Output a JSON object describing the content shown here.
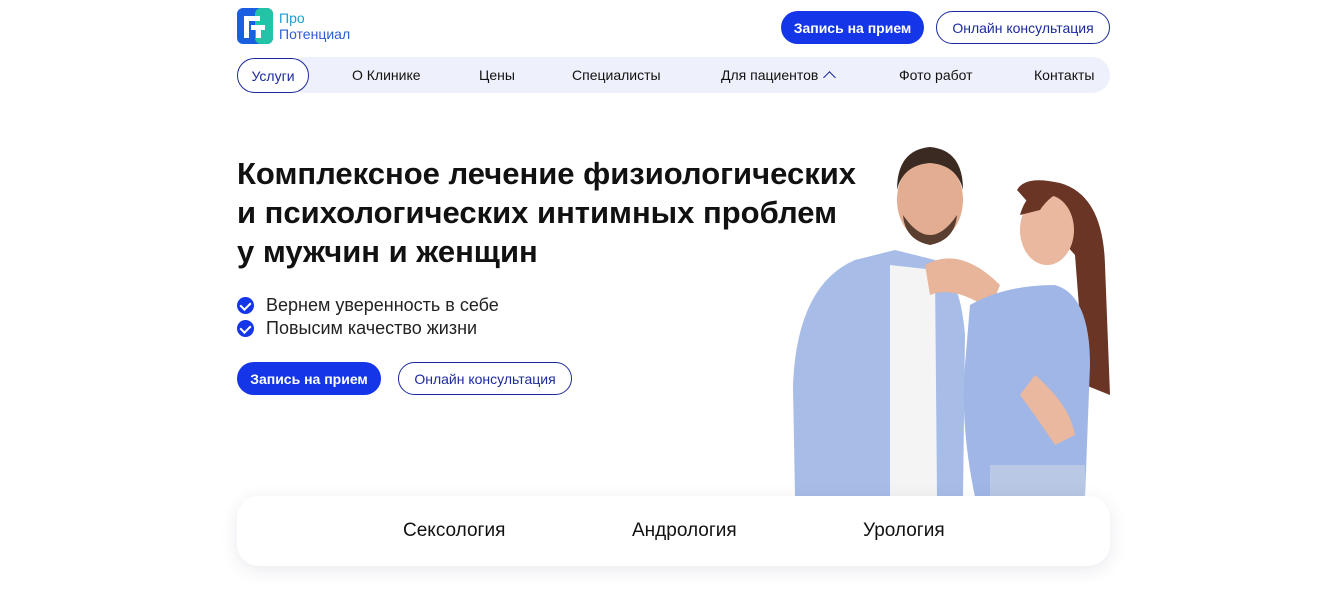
{
  "logo": {
    "line1": "Про",
    "line2": "Потенциал"
  },
  "header": {
    "appointment_label": "Запись на прием",
    "online_label": "Онлайн консультация"
  },
  "nav": {
    "services": "Услуги",
    "items": [
      "О Клинике",
      "Цены",
      "Специалисты",
      "Для пациентов",
      "Фото работ",
      "Контакты"
    ]
  },
  "hero": {
    "title": "Комплексное лечение физиологических и психологических интимных проблем у мужчин и женщин",
    "bullets": [
      "Вернем уверенность в себе",
      "Повысим качество жизни"
    ],
    "appointment_label": "Запись на прием",
    "online_label": "Онлайн консультация"
  },
  "categories": [
    "Сексология",
    "Андрология",
    "Урология"
  ],
  "colors": {
    "accent": "#1436e8",
    "outline": "#1c2a9e",
    "nav_bg": "#eef0fb"
  }
}
